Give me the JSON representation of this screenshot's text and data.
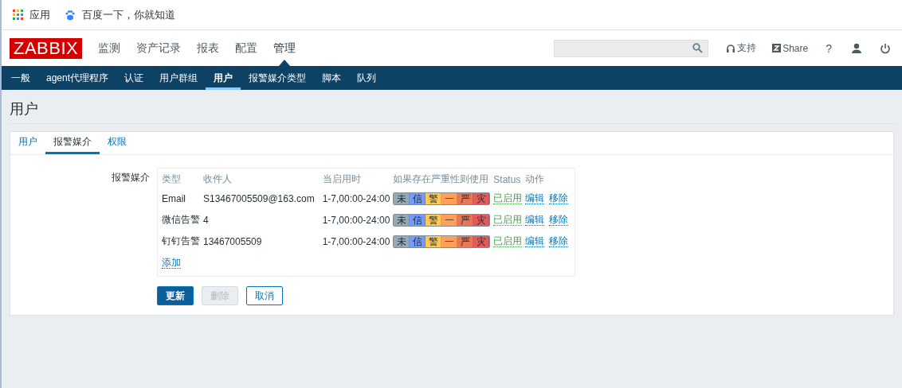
{
  "bookmarks": [
    {
      "kind": "apps",
      "label": "应用"
    },
    {
      "kind": "paw",
      "label": "百度一下，你就知道"
    }
  ],
  "header": {
    "logo": "ZABBIX",
    "menu": [
      {
        "label": "监测",
        "selected": false
      },
      {
        "label": "资产记录",
        "selected": false
      },
      {
        "label": "报表",
        "selected": false
      },
      {
        "label": "配置",
        "selected": false
      },
      {
        "label": "管理",
        "selected": true
      }
    ],
    "support": "支持",
    "share": "Share",
    "help": "?"
  },
  "submenu": [
    {
      "label": "一般",
      "selected": false
    },
    {
      "label": "agent代理程序",
      "selected": false
    },
    {
      "label": "认证",
      "selected": false
    },
    {
      "label": "用户群组",
      "selected": false
    },
    {
      "label": "用户",
      "selected": true
    },
    {
      "label": "报警媒介类型",
      "selected": false
    },
    {
      "label": "脚本",
      "selected": false
    },
    {
      "label": "队列",
      "selected": false
    }
  ],
  "page_title": "用户",
  "tabs": [
    {
      "label": "用户",
      "selected": false
    },
    {
      "label": "报警媒介",
      "selected": true
    },
    {
      "label": "权限",
      "selected": false
    }
  ],
  "media": {
    "label": "报警媒介",
    "columns": [
      "类型",
      "收件人",
      "当启用时",
      "如果存在严重性则使用",
      "Status",
      "动作"
    ],
    "rows": [
      {
        "type": "Email",
        "recipient": "S13467005509@163.com",
        "when": "1-7,00:00-24:00",
        "severities": [
          {
            "label": "未",
            "color": "#97aab3"
          },
          {
            "label": "信",
            "color": "#7499ff"
          },
          {
            "label": "警",
            "color": "#ffc859"
          },
          {
            "label": "一",
            "color": "#ffa059"
          },
          {
            "label": "严",
            "color": "#e97659"
          },
          {
            "label": "灾",
            "color": "#e45959"
          }
        ],
        "status": "已启用",
        "edit": "编辑",
        "remove": "移除"
      },
      {
        "type": "微信告警",
        "recipient": "4",
        "when": "1-7,00:00-24:00",
        "severities": [
          {
            "label": "未",
            "color": "#97aab3"
          },
          {
            "label": "信",
            "color": "#7499ff"
          },
          {
            "label": "警",
            "color": "#ffc859"
          },
          {
            "label": "一",
            "color": "#ffa059"
          },
          {
            "label": "严",
            "color": "#e97659"
          },
          {
            "label": "灾",
            "color": "#e45959"
          }
        ],
        "status": "已启用",
        "edit": "编辑",
        "remove": "移除"
      },
      {
        "type": "钉钉告警",
        "recipient": "13467005509",
        "when": "1-7,00:00-24:00",
        "severities": [
          {
            "label": "未",
            "color": "#97aab3"
          },
          {
            "label": "信",
            "color": "#7499ff"
          },
          {
            "label": "警",
            "color": "#ffc859"
          },
          {
            "label": "一",
            "color": "#ffa059"
          },
          {
            "label": "严",
            "color": "#e97659"
          },
          {
            "label": "灾",
            "color": "#e45959"
          }
        ],
        "status": "已启用",
        "edit": "编辑",
        "remove": "移除"
      }
    ],
    "add": "添加"
  },
  "buttons": [
    {
      "kind": "primary",
      "label": "更新",
      "disabled": false
    },
    {
      "kind": "secondary",
      "label": "删除",
      "disabled": true
    },
    {
      "kind": "secondary",
      "label": "取消",
      "disabled": false
    }
  ]
}
